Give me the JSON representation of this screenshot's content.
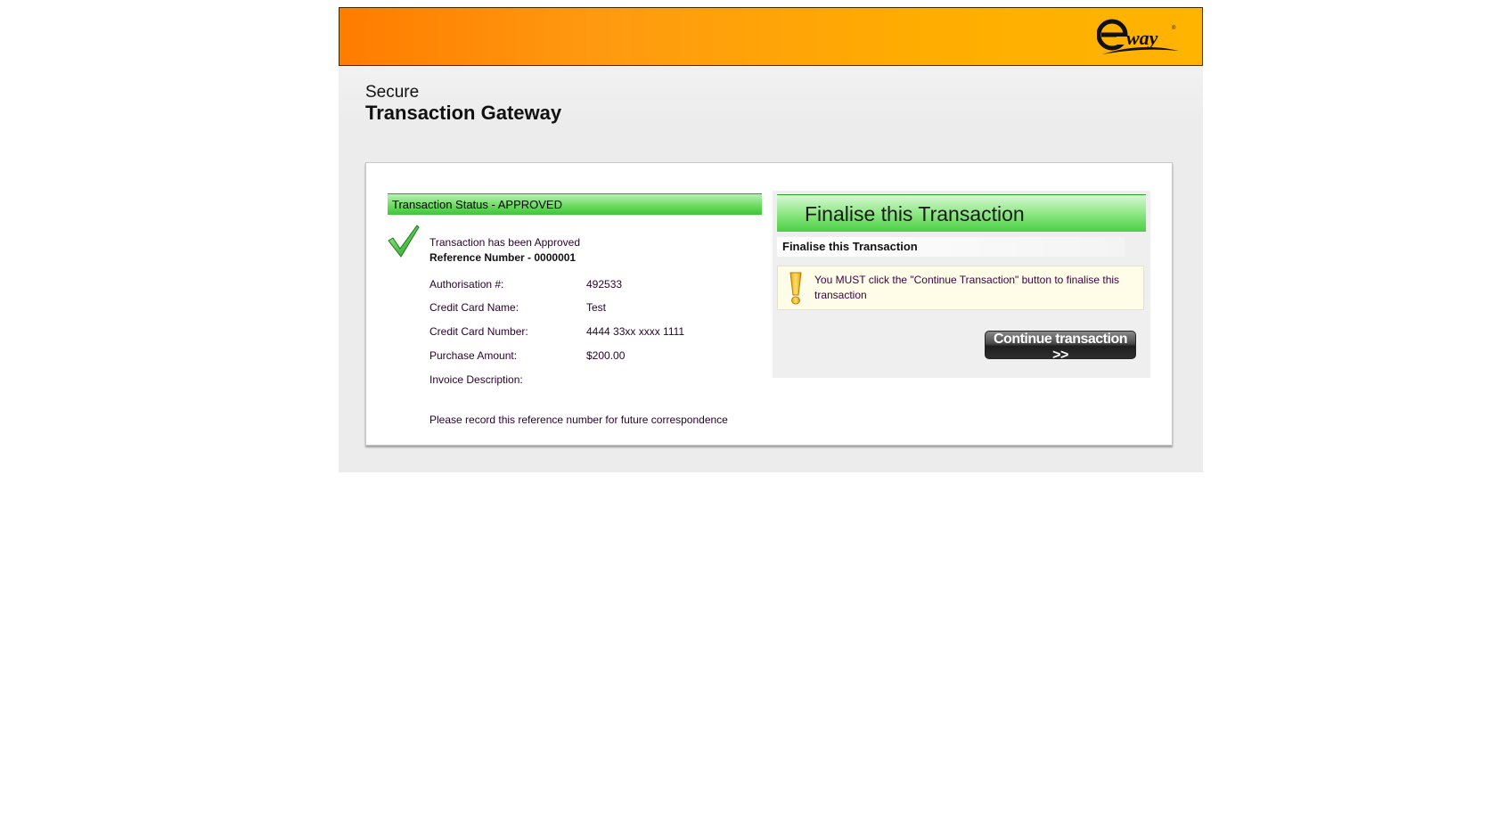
{
  "banner": {
    "logo_text": "eway",
    "accent_color": "#ff8400"
  },
  "gateway": {
    "title_line1": "Secure",
    "title_line2": "Transaction Gateway"
  },
  "status": {
    "header": "Transaction Status - APPROVED",
    "check_icon": "check-mark-icon",
    "approved_message": "Transaction has been Approved",
    "reference": "Reference Number - 0000001",
    "details": [
      {
        "label": "Authorisation #:",
        "value": "492533"
      },
      {
        "label": "Credit Card Name:",
        "value": "Test"
      },
      {
        "label": "Credit Card Number:",
        "value": "4444 33xx xxxx 1111"
      },
      {
        "label": "Purchase Amount:",
        "value": "$200.00"
      },
      {
        "label": "Invoice Description:",
        "value": ""
      }
    ],
    "footnote": "Please record this reference number for future correspondence",
    "status_color": "#3fc43a"
  },
  "finalise": {
    "header": "Finalise this Transaction",
    "subheader": "Finalise this Transaction",
    "warning_icon": "exclamation-icon",
    "warning_text": "You MUST click the \"Continue Transaction\" button to finalise this transaction",
    "continue_label": "Continue transaction >>"
  }
}
